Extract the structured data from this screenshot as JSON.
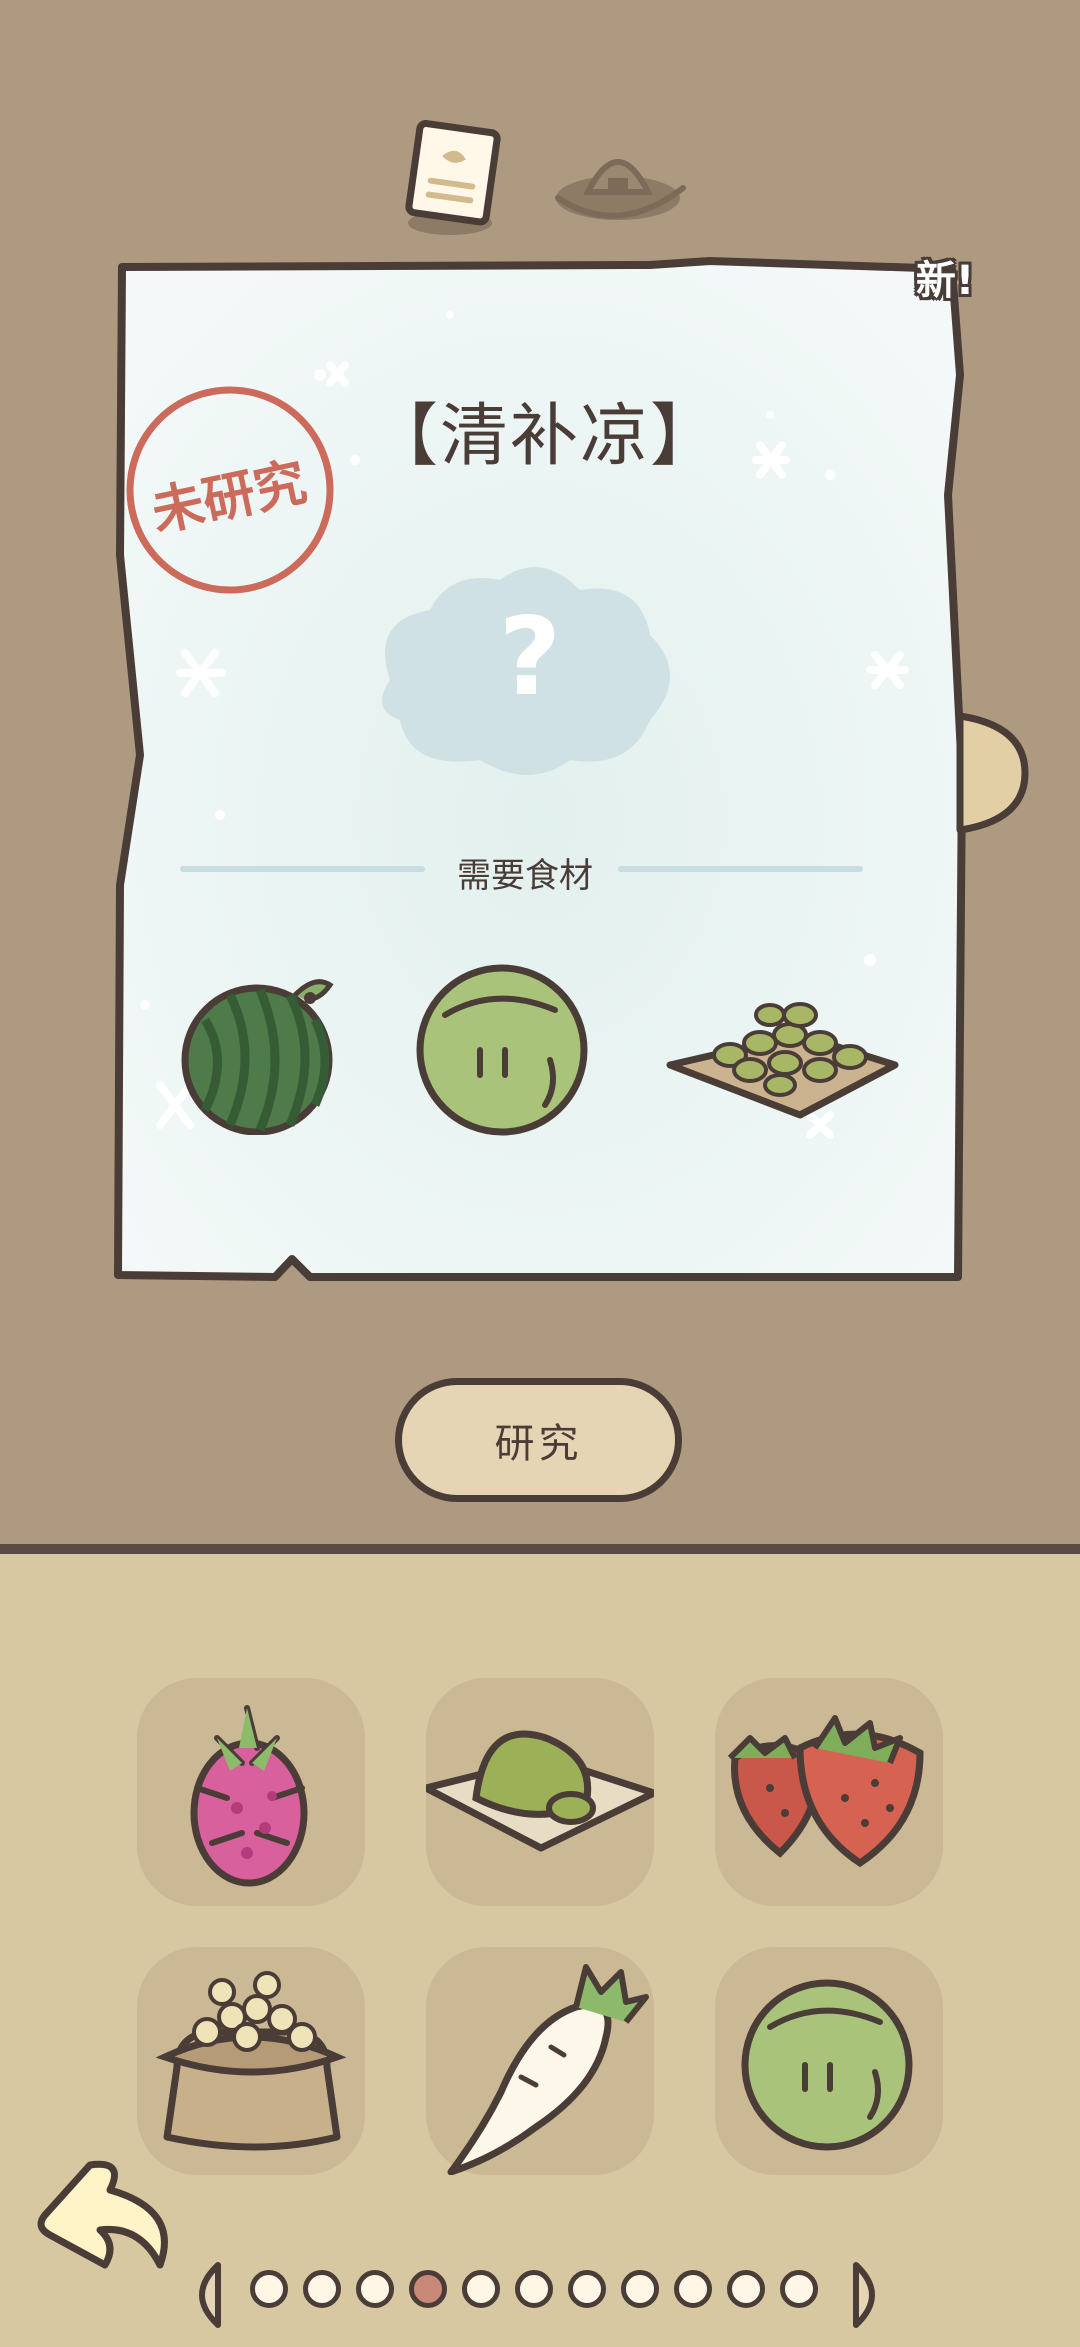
{
  "tabs": [
    {
      "name": "recipe-note-tab",
      "icon": "recipe-note-icon"
    },
    {
      "name": "rice-ball-tab",
      "icon": "rice-ball-icon"
    }
  ],
  "recipe_card": {
    "new_badge": "新!",
    "title": "【清补凉】",
    "stamp": "未研究",
    "mystery_mark": "?",
    "ingredients_label": "需要食材",
    "ingredients": [
      "watermelon-icon",
      "plum-icon",
      "soybean-plate-icon"
    ]
  },
  "research_button": "研究",
  "inventory": [
    "dragon-fruit-icon",
    "matcha-dessert-icon",
    "strawberry-icon",
    "soybean-sack-icon",
    "daikon-icon",
    "plum-icon"
  ],
  "pager": {
    "total": 11,
    "current": 4
  },
  "colors": {
    "background": "#ad9a80",
    "panel": "#d8c8a2",
    "outline": "#4a3c37",
    "stamp": "#cc6b5c",
    "paper": "#eaf4f2"
  }
}
